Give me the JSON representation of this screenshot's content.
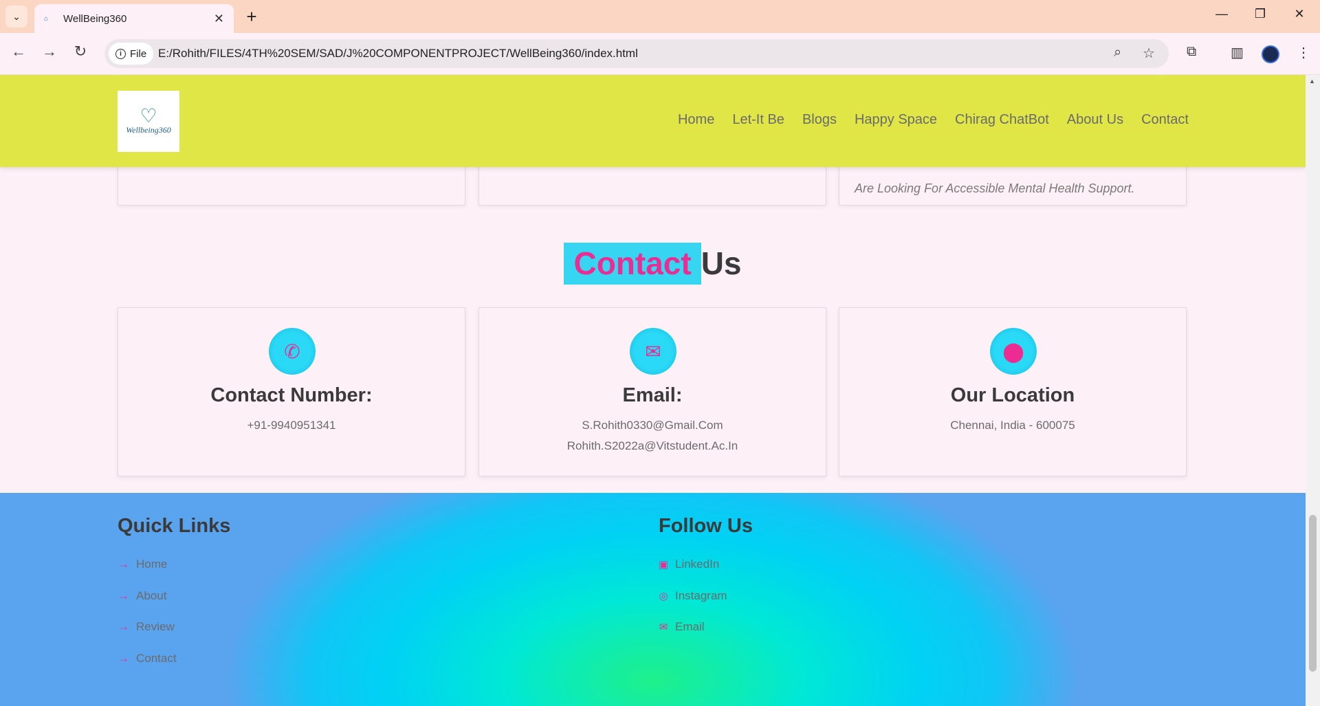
{
  "browser": {
    "tab_title": "WellBeing360",
    "url_chip": "File",
    "url": "E:/Rohith/FILES/4TH%20SEM/SAD/J%20COMPONENTPROJECT/WellBeing360/index.html"
  },
  "site": {
    "logo_text": "Wellbeing360",
    "nav": [
      "Home",
      "Let-It Be",
      "Blogs",
      "Happy Space",
      "Chirag ChatBot",
      "About Us",
      "Contact"
    ]
  },
  "previous_section": {
    "card3_text": "Are Looking For Accessible Mental Health Support."
  },
  "contact": {
    "title_highlight": "Contact",
    "title_rest": "Us",
    "cards": [
      {
        "icon": "phone-icon",
        "title": "Contact Number:",
        "lines": [
          "+91-9940951341"
        ]
      },
      {
        "icon": "envelope-icon",
        "title": "Email:",
        "lines": [
          "S.Rohith0330@Gmail.Com",
          "Rohith.S2022a@Vitstudent.Ac.In"
        ]
      },
      {
        "icon": "location-pin-icon",
        "title": "Our Location",
        "lines": [
          "Chennai, India - 600075"
        ]
      }
    ]
  },
  "footer": {
    "quick_links_title": "Quick Links",
    "quick_links": [
      "Home",
      "About",
      "Review",
      "Contact"
    ],
    "follow_title": "Follow Us",
    "follow_links": [
      {
        "icon": "linkedin-icon",
        "label": "LinkedIn"
      },
      {
        "icon": "instagram-icon",
        "label": "Instagram"
      },
      {
        "icon": "email-icon",
        "label": "Email"
      }
    ]
  },
  "colors": {
    "header_bg": "#e0e645",
    "accent_pink": "#ec2c93",
    "accent_cyan": "#36d6f2"
  }
}
